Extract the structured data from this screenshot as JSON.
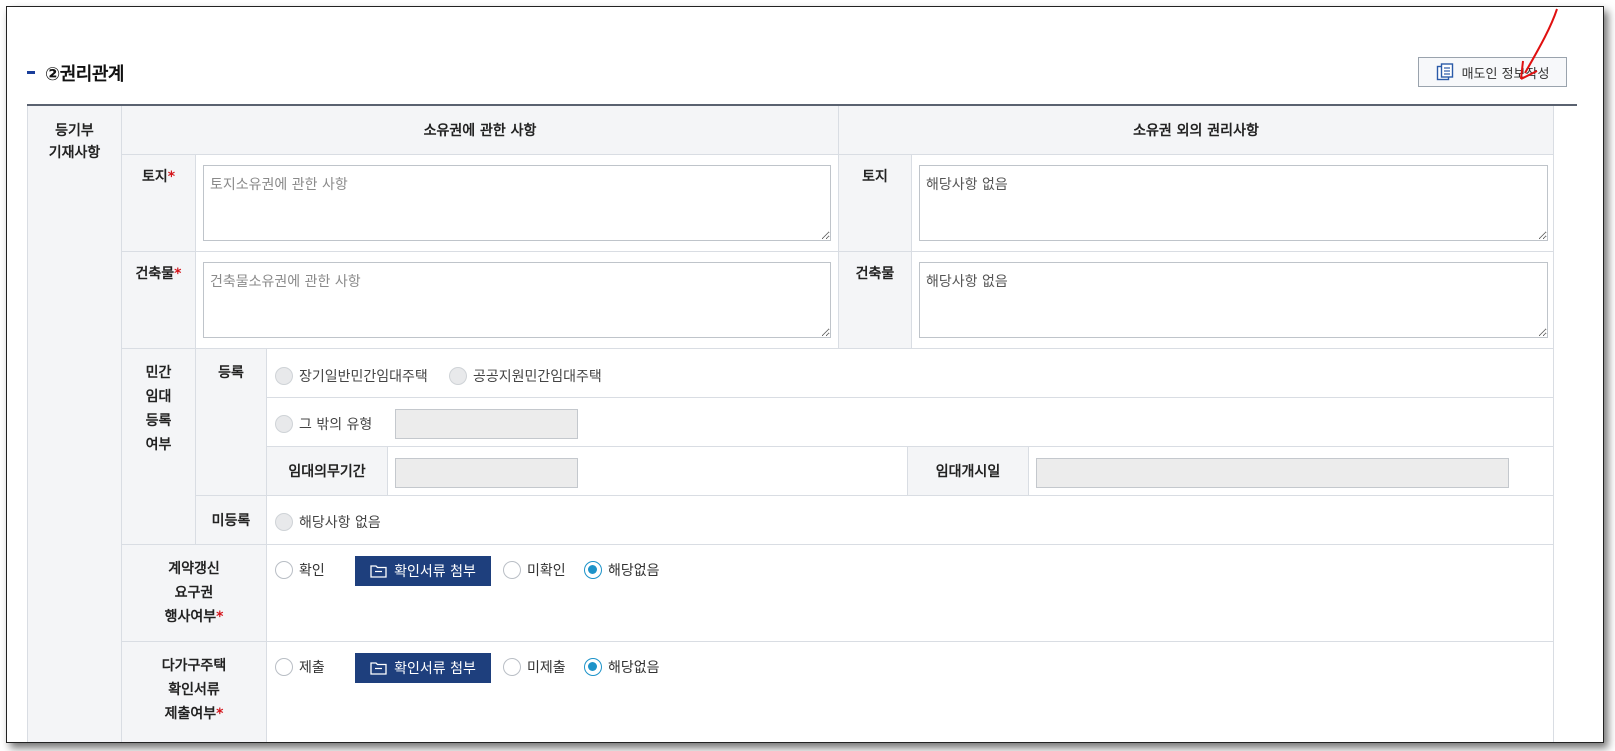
{
  "section": {
    "title": "②권리관계"
  },
  "seller_button": {
    "label": "매도인 정보작성",
    "icon": "document-stack-icon"
  },
  "registry": {
    "row_label_line1": "등기부",
    "row_label_line2": "기재사항",
    "col_ownership": "소유권에 관한 사항",
    "col_other_rights": "소유권 외의 권리사항",
    "land_label": "토지",
    "building_label": "건축물",
    "required_mark": "*",
    "land_ownership_placeholder": "토지소유권에 관한 사항",
    "building_ownership_placeholder": "건축물소유권에 관한 사항",
    "land_other_value": "해당사항 없음",
    "building_other_value": "해당사항 없음"
  },
  "private_rental": {
    "label_lines": [
      "민간",
      "임대",
      "등록",
      "여부"
    ],
    "registered_label": "등록",
    "options": [
      "장기일반민간임대주택",
      "공공지원민간임대주택"
    ],
    "other_type_label": "그 밖의 유형",
    "obligation_period_label": "임대의무기간",
    "start_date_label": "임대개시일",
    "unregistered_label": "미등록",
    "unregistered_option": "해당사항 없음"
  },
  "renewal": {
    "label_lines": [
      "계약갱신",
      "요구권",
      "행사여부"
    ],
    "opt_confirm": "확인",
    "attach_label": "확인서류 첨부",
    "opt_unconfirmed": "미확인",
    "opt_na": "해당없음",
    "selected": "해당없음"
  },
  "multi_house": {
    "label_lines": [
      "다가구주택",
      "확인서류",
      "제출여부"
    ],
    "opt_submit": "제출",
    "attach_label": "확인서류 첨부",
    "opt_not_submitted": "미제출",
    "opt_na": "해당없음",
    "selected": "해당없음"
  },
  "colors": {
    "accent": "#1e3f7d",
    "radio_checked": "#1d93c9",
    "required": "#d4141a",
    "annotation_arrow": "#e01010"
  }
}
